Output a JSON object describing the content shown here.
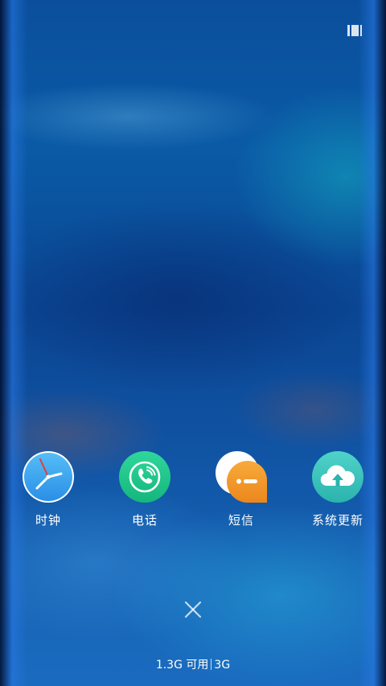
{
  "apps": [
    {
      "id": "clock",
      "label": "时钟",
      "icon": "clock-icon"
    },
    {
      "id": "phone",
      "label": "电话",
      "icon": "phone-icon"
    },
    {
      "id": "messages",
      "label": "短信",
      "icon": "message-icon"
    },
    {
      "id": "system-update",
      "label": "系统更新",
      "icon": "cloud-upload-icon"
    }
  ],
  "memory": {
    "available": "1.3G 可用",
    "total": "3G"
  },
  "status_bar": {
    "icon": "recent-apps-icon"
  },
  "controls": {
    "close_icon": "close-icon"
  },
  "colors": {
    "clock_bg": "#3aa9f4",
    "phone_bg": "#21c98c",
    "message_bubble": "#f39a2a",
    "update_bg": "#3cc6c0",
    "text": "#ffffff"
  }
}
